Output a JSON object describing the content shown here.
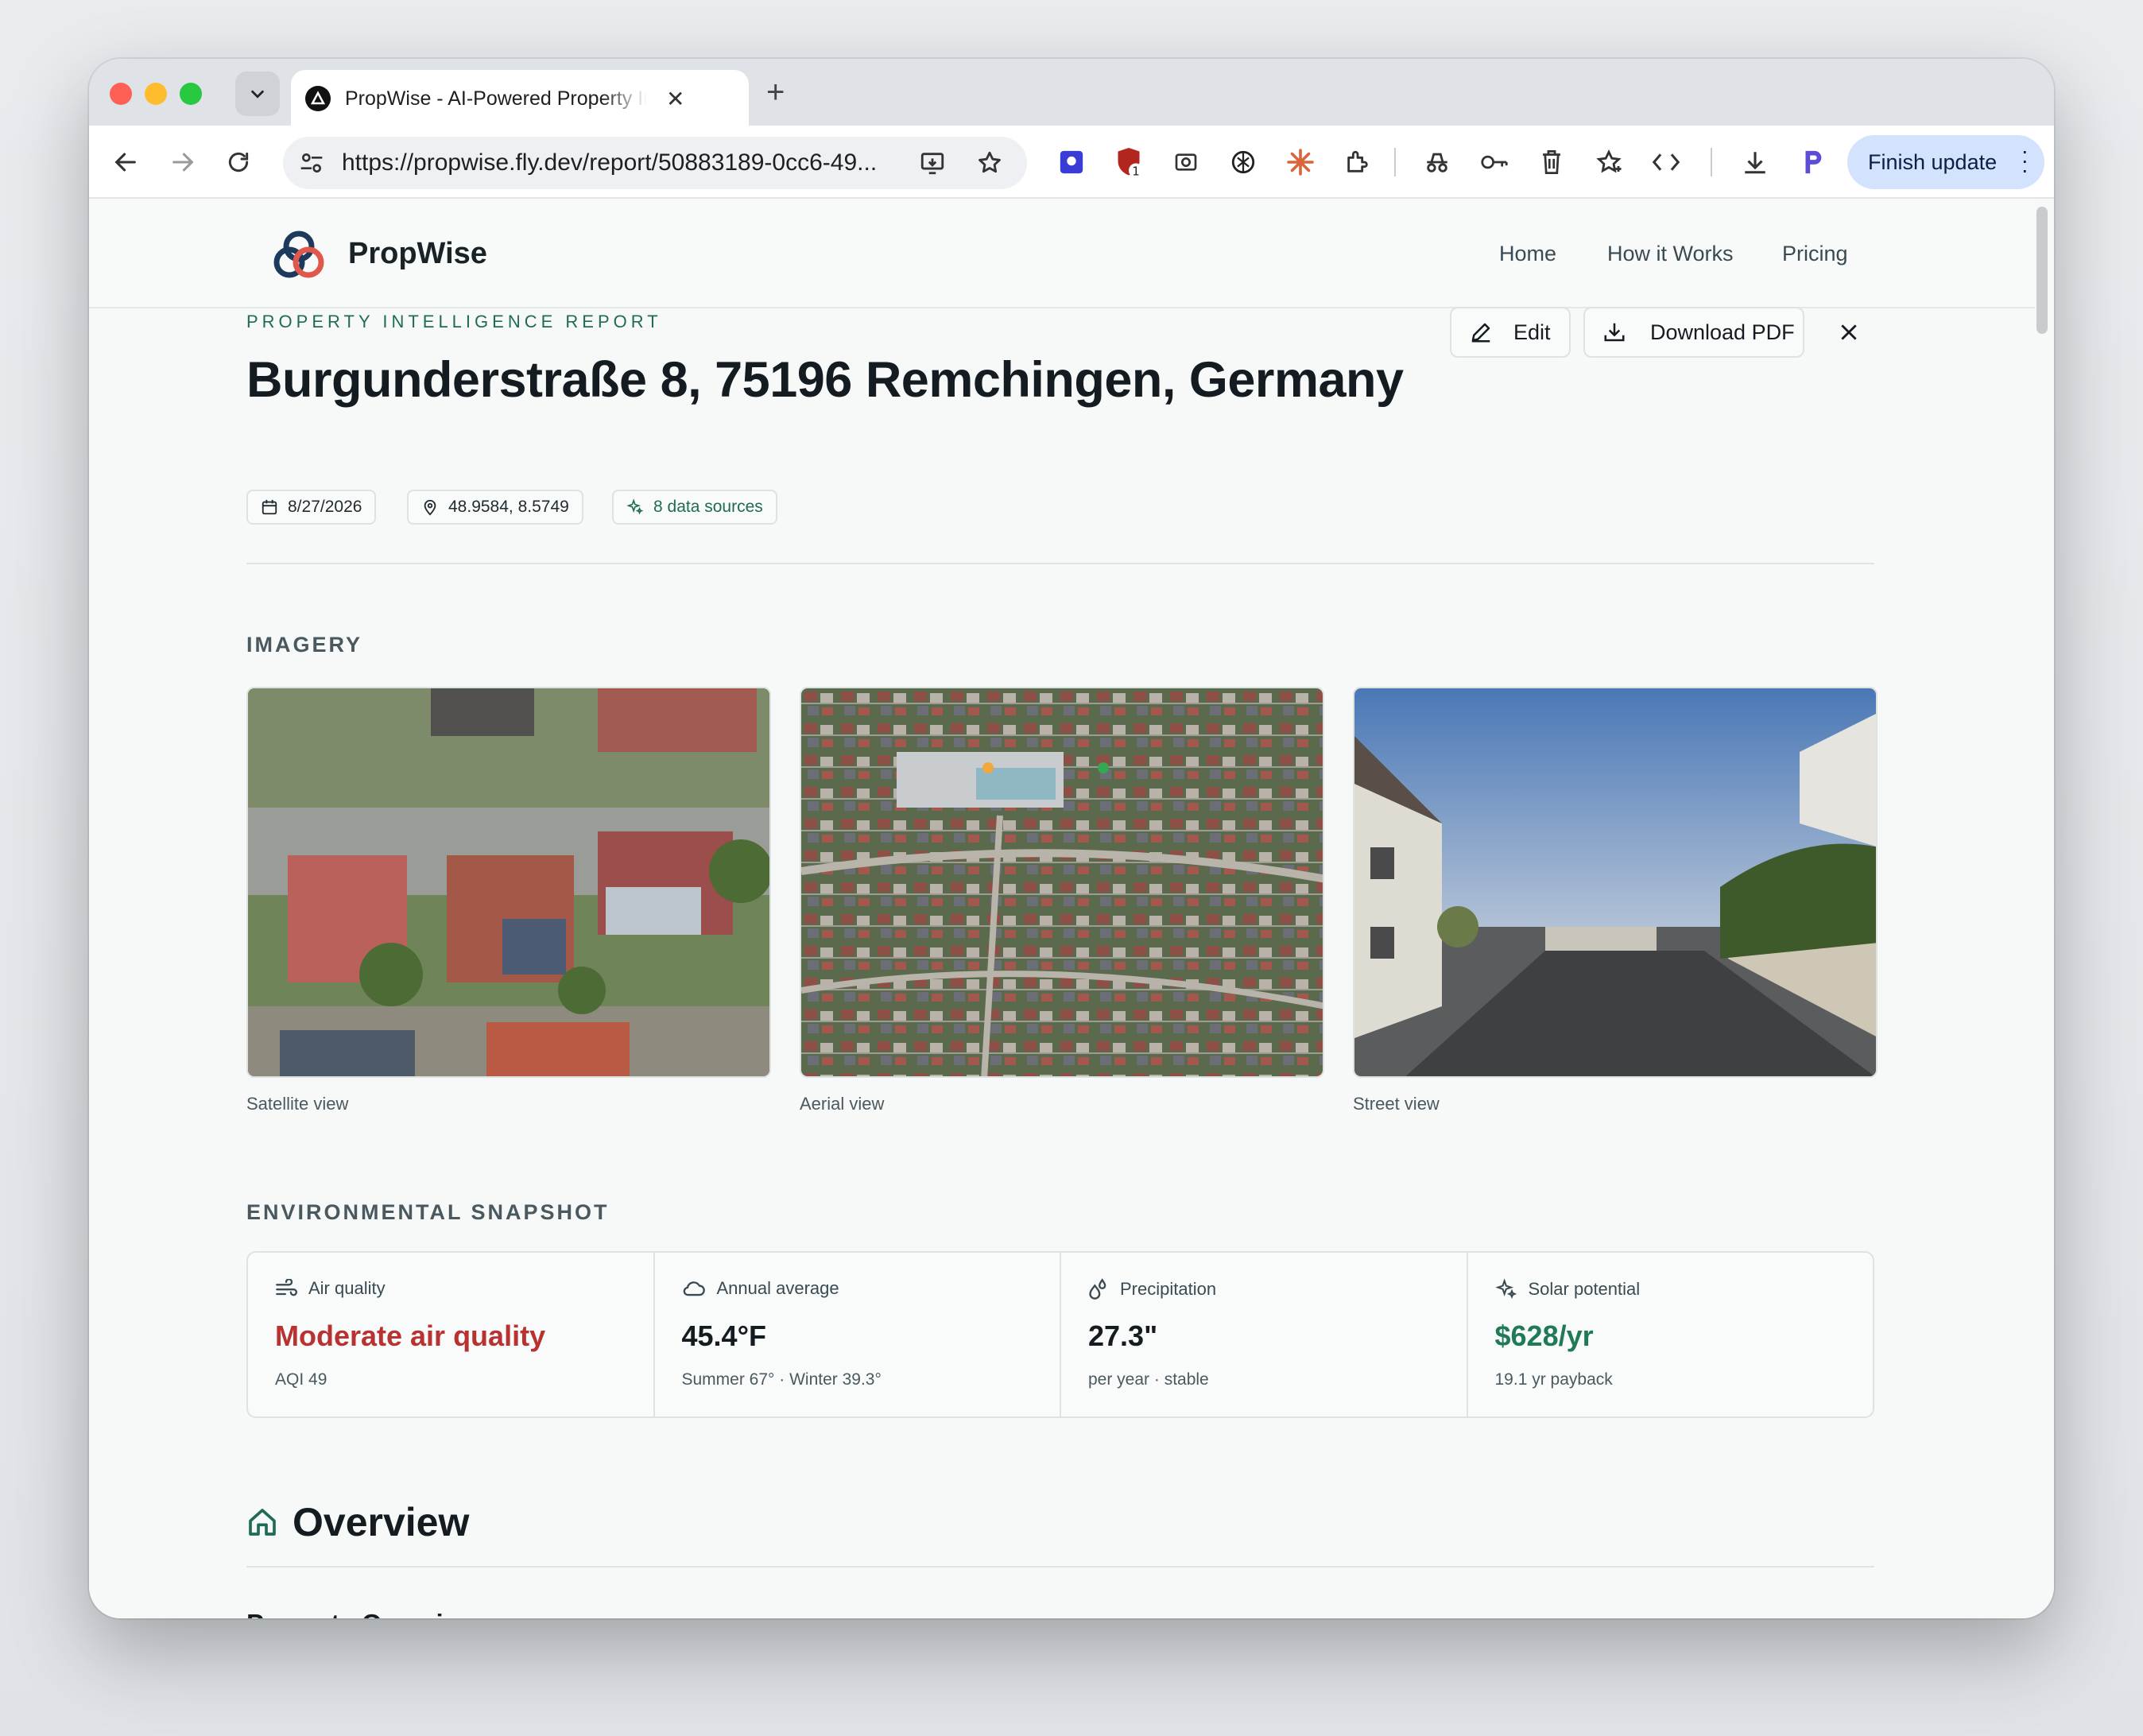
{
  "browser": {
    "tab_title": "PropWise - AI-Powered Property Intelligence",
    "url": "https://propwise.fly.dev/report/50883189-0cc6-49...",
    "finish_update_label": "Finish update",
    "extension_badge": "1"
  },
  "site": {
    "brand": "PropWise",
    "nav": [
      "Home",
      "How it Works",
      "Pricing"
    ]
  },
  "report": {
    "eyebrow": "PROPERTY INTELLIGENCE REPORT",
    "title": "Burgunderstraße 8, 75196 Remchingen, Germany",
    "edit_label": "Edit",
    "download_label": "Download PDF",
    "date": "8/27/2026",
    "coords": "48.9584, 8.5749",
    "sources": "8 data sources"
  },
  "imagery": {
    "heading": "IMAGERY",
    "captions": [
      "Satellite view",
      "Aerial view",
      "Street view"
    ]
  },
  "environment": {
    "heading": "ENVIRONMENTAL SNAPSHOT",
    "cards": [
      {
        "label": "Air quality",
        "value": "Moderate air quality",
        "sub": "AQI 49",
        "color": "#b83232"
      },
      {
        "label": "Annual average",
        "value": "45.4°F",
        "sub": "Summer 67° · Winter 39.3°",
        "color": "#141c21"
      },
      {
        "label": "Precipitation",
        "value": "27.3\"",
        "sub": "per year · stable",
        "color": "#141c21"
      },
      {
        "label": "Solar potential",
        "value": "$628/yr",
        "sub": "19.1 yr payback",
        "color": "#1f7a55"
      }
    ]
  },
  "overview": {
    "heading": "Overview",
    "subheading": "Property Overview"
  }
}
